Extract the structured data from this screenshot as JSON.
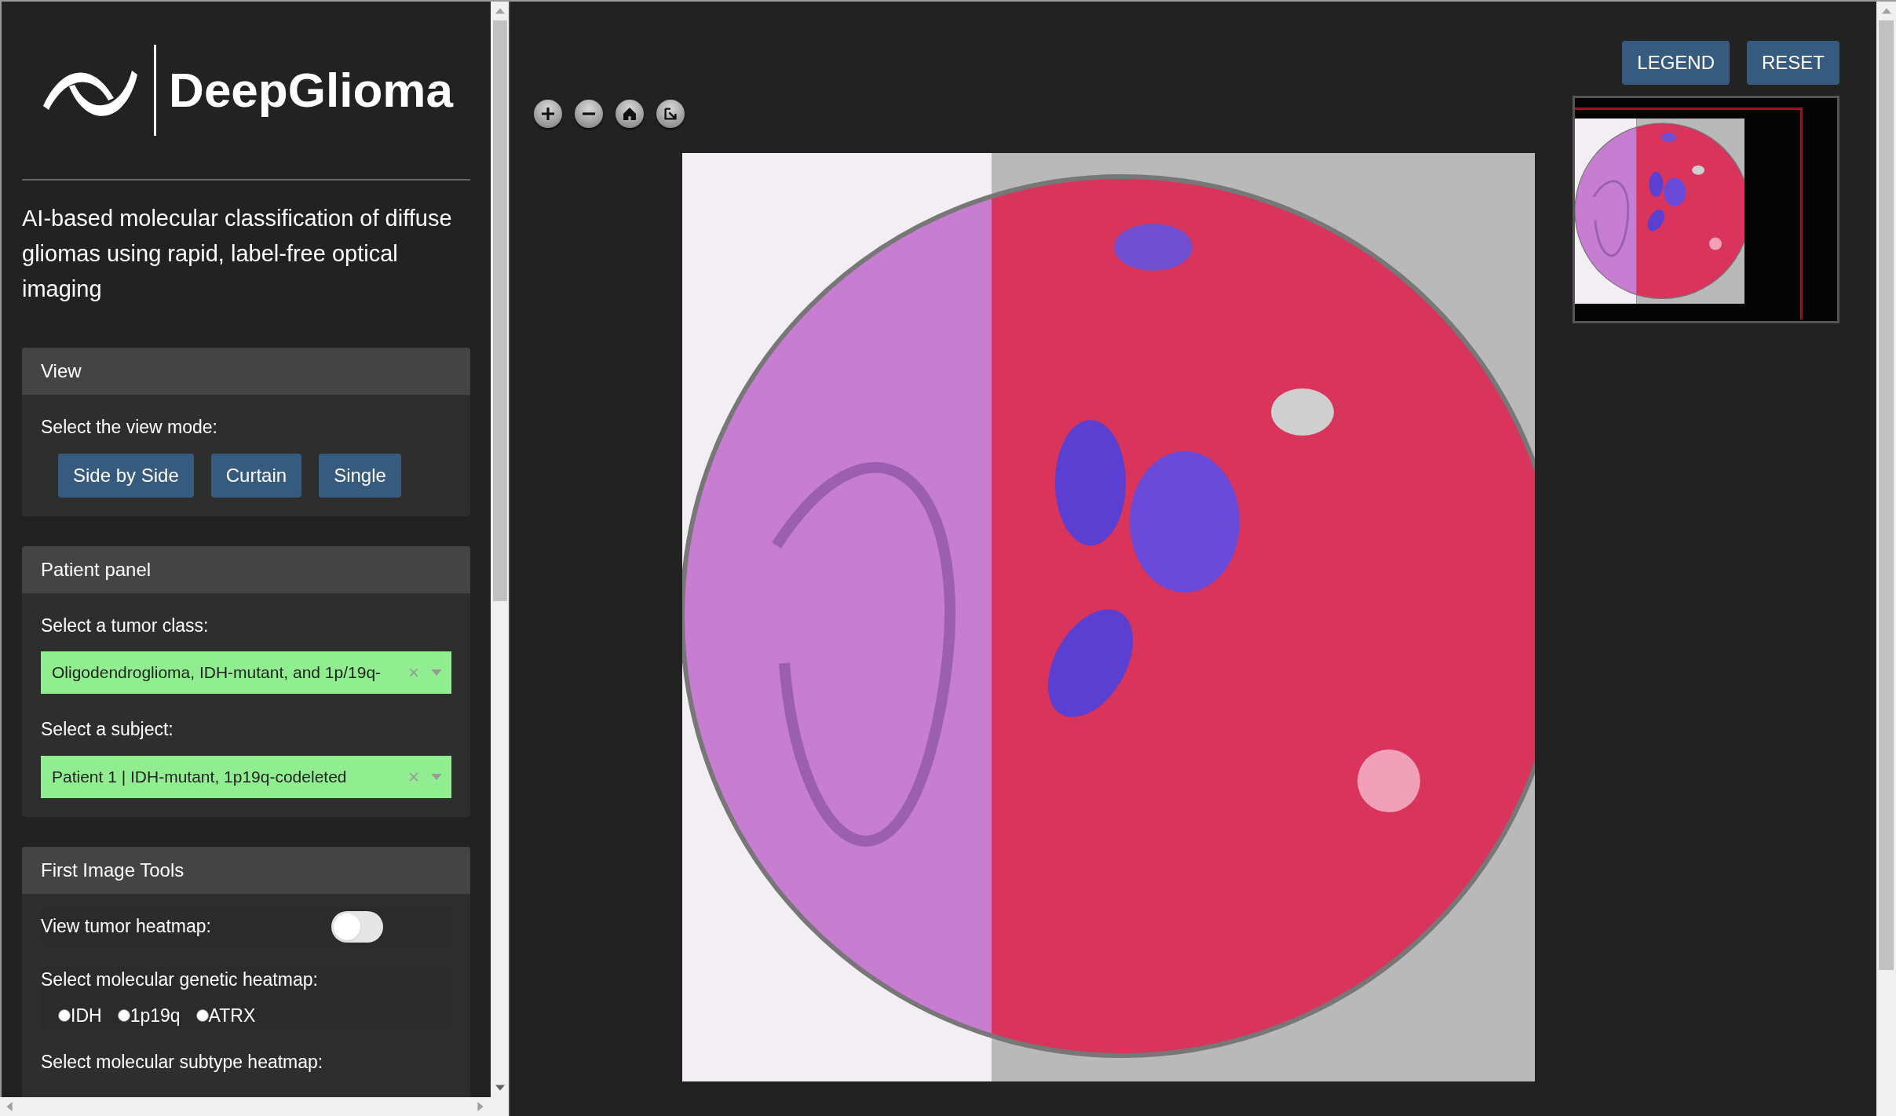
{
  "sidebar": {
    "logo": {
      "name": "DeepGlioma"
    },
    "tagline": "AI-based molecular classification of diffuse gliomas using rapid, label-free optical imaging",
    "view_panel": {
      "title": "View",
      "label": "Select the view mode:",
      "buttons": [
        "Side by Side",
        "Curtain",
        "Single"
      ]
    },
    "patient_panel": {
      "title": "Patient panel",
      "fields": [
        {
          "label": "Select a tumor class:",
          "value": "Oligodendroglioma, IDH-mutant, and 1p/19q-"
        },
        {
          "label": "Select a subject:",
          "value": "Patient 1 | IDH-mutant, 1p19q-codeleted"
        }
      ]
    },
    "first_image_tools": {
      "title": "First Image Tools",
      "tumor_heatmap": {
        "label": "View tumor heatmap:",
        "on": false
      },
      "genetic_heatmap": {
        "label": "Select molecular genetic heatmap:",
        "options": [
          {
            "label": "IDH",
            "selected": false
          },
          {
            "label": "1p19q",
            "selected": false
          },
          {
            "label": "ATRX",
            "selected": false
          }
        ]
      },
      "subtype_heatmap": {
        "label": "Select molecular subtype heatmap:"
      }
    }
  },
  "viewer": {
    "buttons": [
      "LEGEND",
      "RESET"
    ]
  }
}
